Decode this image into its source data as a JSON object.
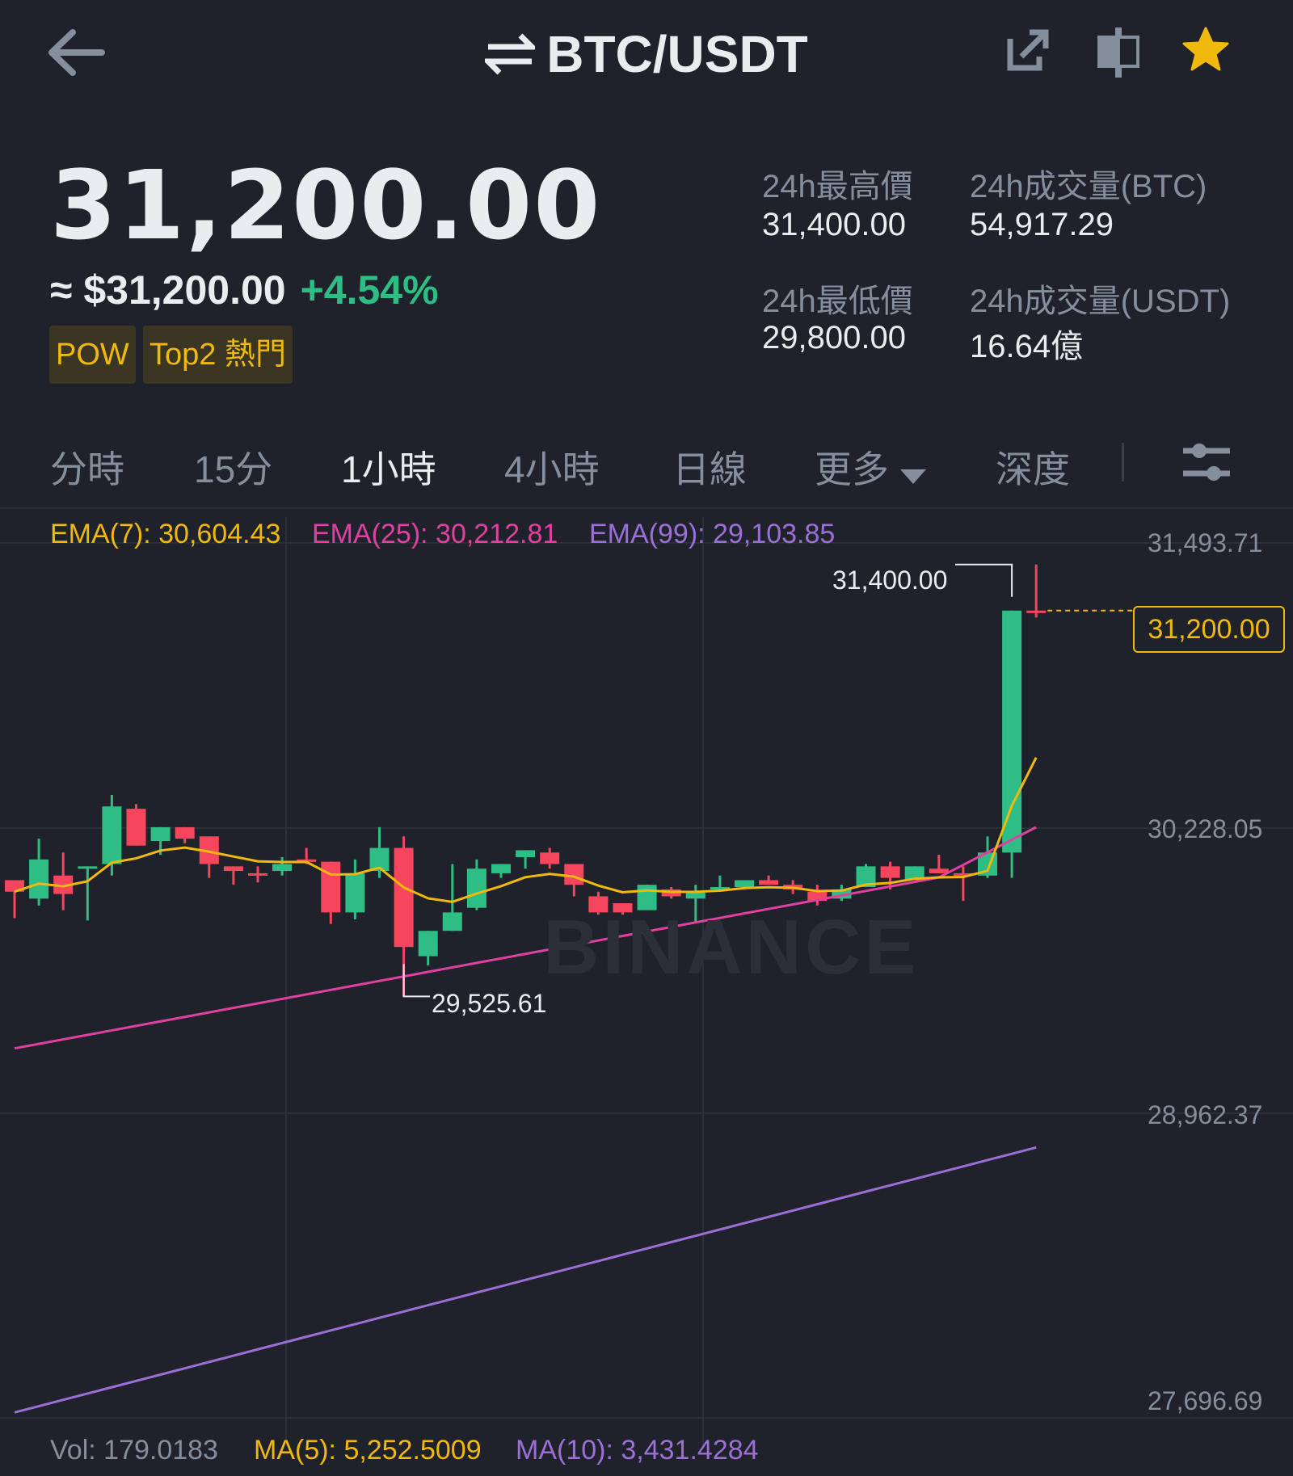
{
  "header": {
    "pair": "BTC/USDT",
    "icons": [
      "back-arrow-icon",
      "swap-icon",
      "share-icon",
      "layout-icon",
      "star-icon"
    ]
  },
  "price": {
    "last": "31,200.00",
    "fiat": "≈ $31,200.00",
    "change": "+4.54%",
    "tags": [
      "POW",
      "Top2 熱門"
    ]
  },
  "stats": {
    "high_label": "24h最高價",
    "high_value": "31,400.00",
    "low_label": "24h最低價",
    "low_value": "29,800.00",
    "vol_btc_label": "24h成交量(BTC)",
    "vol_btc_value": "54,917.29",
    "vol_usdt_label": "24h成交量(USDT)",
    "vol_usdt_value": "16.64億"
  },
  "tabs": [
    "分時",
    "15分",
    "1小時",
    "4小時",
    "日線",
    "更多",
    "深度"
  ],
  "active_tab": "1小時",
  "indicators": {
    "ema7": "EMA(7): 30,604.43",
    "ema25": "EMA(25): 30,212.81",
    "ema99": "EMA(99): 29,103.85"
  },
  "volume_bar": {
    "vol": "Vol: 179.0183",
    "ma5": "MA(5): 5,252.5009",
    "ma10": "MA(10): 3,431.4284"
  },
  "watermark": "BINANCE",
  "colors": {
    "up": "#2ebd85",
    "down": "#f6465d",
    "accent": "#f0b90b",
    "ema7": "#f0b90b",
    "ema25": "#e040a0",
    "ema99": "#9b6fd6"
  },
  "chart_data": {
    "type": "candlestick",
    "yaxis_ticks": [
      "31,493.71",
      "30,228.05",
      "28,962.37",
      "27,696.69"
    ],
    "ylim": [
      27696.69,
      31493.71
    ],
    "last_price": "31,200.00",
    "high_marker": "31,400.00",
    "low_marker": "29,525.61",
    "candles": [
      {
        "o": 30030,
        "h": 30030,
        "l": 29865,
        "c": 29980
      },
      {
        "o": 29950,
        "h": 30210,
        "l": 29920,
        "c": 30120
      },
      {
        "o": 30050,
        "h": 30150,
        "l": 29900,
        "c": 29970
      },
      {
        "o": 30080,
        "h": 30050,
        "l": 29855,
        "c": 30090
      },
      {
        "o": 30100,
        "h": 30400,
        "l": 30050,
        "c": 30350
      },
      {
        "o": 30340,
        "h": 30360,
        "l": 30180,
        "c": 30180
      },
      {
        "o": 30200,
        "h": 30260,
        "l": 30140,
        "c": 30260
      },
      {
        "o": 30260,
        "h": 30260,
        "l": 30190,
        "c": 30210
      },
      {
        "o": 30220,
        "h": 30220,
        "l": 30040,
        "c": 30100
      },
      {
        "o": 30090,
        "h": 30090,
        "l": 30010,
        "c": 30070
      },
      {
        "o": 30060,
        "h": 30090,
        "l": 30020,
        "c": 30050
      },
      {
        "o": 30070,
        "h": 30130,
        "l": 30050,
        "c": 30100
      },
      {
        "o": 30120,
        "h": 30170,
        "l": 30100,
        "c": 30110
      },
      {
        "o": 30110,
        "h": 30110,
        "l": 29840,
        "c": 29890
      },
      {
        "o": 29890,
        "h": 30120,
        "l": 29860,
        "c": 30060
      },
      {
        "o": 30070,
        "h": 30260,
        "l": 30040,
        "c": 30170
      },
      {
        "o": 30170,
        "h": 30220,
        "l": 29525.61,
        "c": 29740
      },
      {
        "o": 29700,
        "h": 29810,
        "l": 29660,
        "c": 29810
      },
      {
        "o": 29810,
        "h": 30100,
        "l": 29810,
        "c": 29890
      },
      {
        "o": 29910,
        "h": 30120,
        "l": 29900,
        "c": 30080
      },
      {
        "o": 30060,
        "h": 30100,
        "l": 30040,
        "c": 30100
      },
      {
        "o": 30130,
        "h": 30160,
        "l": 30080,
        "c": 30160
      },
      {
        "o": 30150,
        "h": 30170,
        "l": 30080,
        "c": 30100
      },
      {
        "o": 30100,
        "h": 30100,
        "l": 29960,
        "c": 30010
      },
      {
        "o": 29960,
        "h": 29980,
        "l": 29880,
        "c": 29890
      },
      {
        "o": 29930,
        "h": 29930,
        "l": 29880,
        "c": 29890
      },
      {
        "o": 29900,
        "h": 30010,
        "l": 29900,
        "c": 30010
      },
      {
        "o": 29990,
        "h": 30000,
        "l": 29950,
        "c": 29960
      },
      {
        "o": 29950,
        "h": 30010,
        "l": 29850,
        "c": 29980
      },
      {
        "o": 29990,
        "h": 30050,
        "l": 29980,
        "c": 30000
      },
      {
        "o": 30000,
        "h": 30030,
        "l": 29990,
        "c": 30030
      },
      {
        "o": 30030,
        "h": 30050,
        "l": 30010,
        "c": 30010
      },
      {
        "o": 30010,
        "h": 30030,
        "l": 29970,
        "c": 29990
      },
      {
        "o": 29980,
        "h": 30010,
        "l": 29920,
        "c": 29940
      },
      {
        "o": 29950,
        "h": 30010,
        "l": 29940,
        "c": 29990
      },
      {
        "o": 30000,
        "h": 30100,
        "l": 30000,
        "c": 30090
      },
      {
        "o": 30090,
        "h": 30110,
        "l": 29990,
        "c": 30040
      },
      {
        "o": 30030,
        "h": 30090,
        "l": 30030,
        "c": 30090
      },
      {
        "o": 30080,
        "h": 30140,
        "l": 30070,
        "c": 30060
      },
      {
        "o": 30060,
        "h": 30090,
        "l": 29940,
        "c": 30050
      },
      {
        "o": 30050,
        "h": 30220,
        "l": 30040,
        "c": 30150
      },
      {
        "o": 30150,
        "h": 30330,
        "l": 30040,
        "c": 31200
      },
      {
        "o": 31200,
        "h": 31400,
        "l": 31170,
        "c": 31190
      }
    ]
  }
}
